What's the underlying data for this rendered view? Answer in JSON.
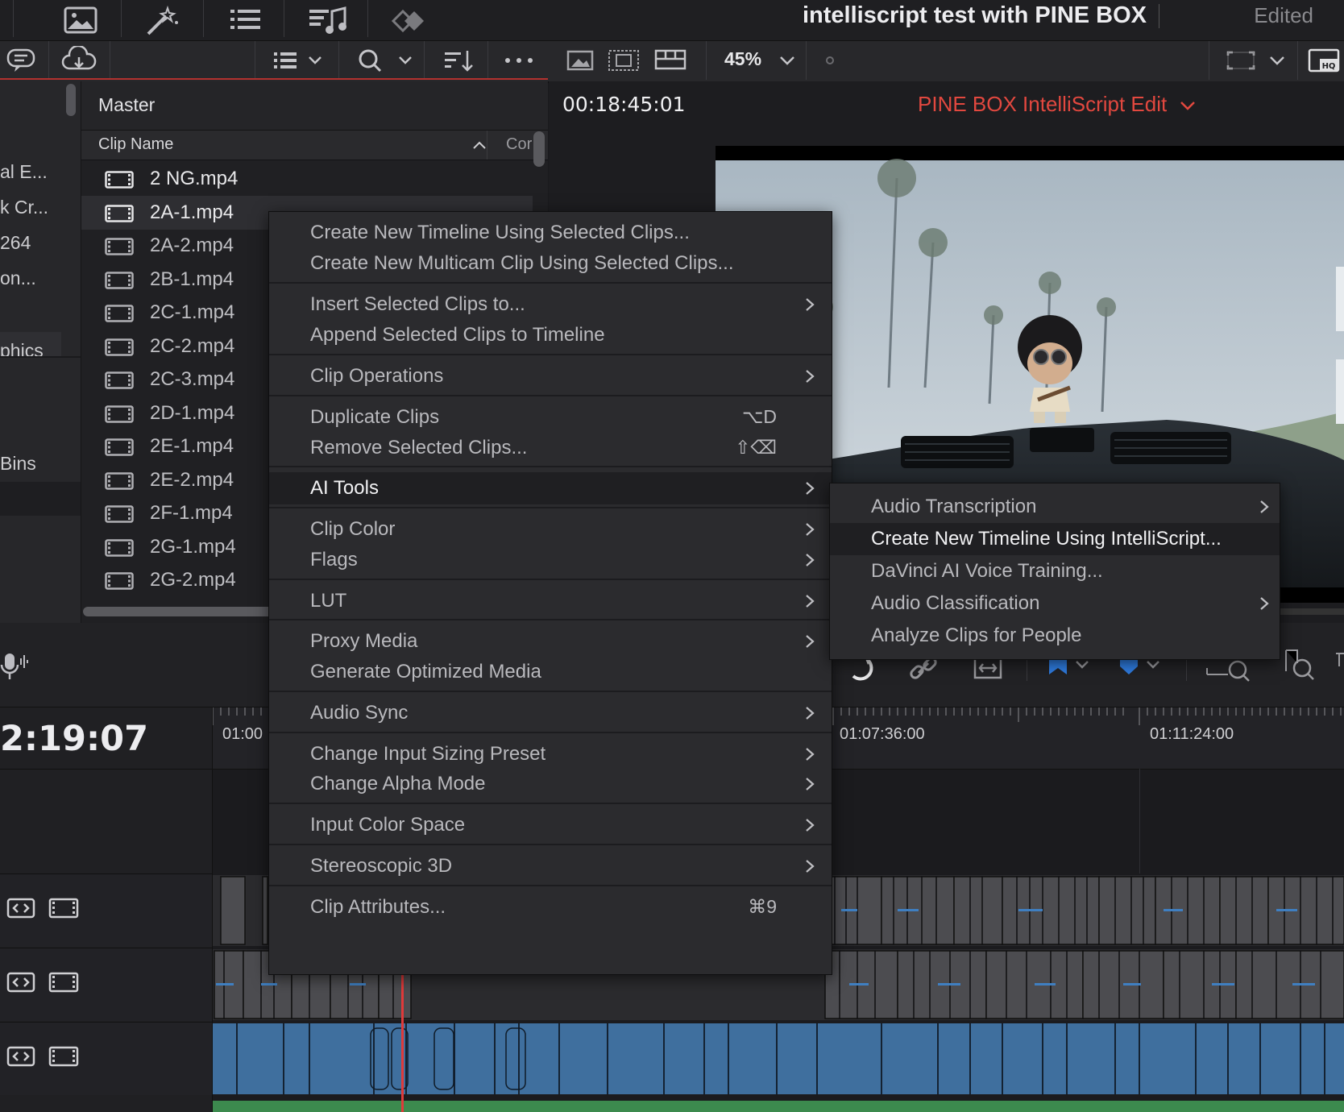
{
  "project": {
    "title": "intelliscript test with PINE BOX",
    "status": "Edited"
  },
  "toolbar": {
    "zoom": "45%"
  },
  "bins": {
    "labels": [
      "al E...",
      "k Cr...",
      "264",
      "on...",
      "phics",
      "Bins"
    ]
  },
  "media_pool": {
    "bin_name": "Master",
    "column_clip_name": "Clip Name",
    "column_cor": "Cor",
    "clips": [
      "2 NG.mp4",
      "2A-1.mp4",
      "2A-2.mp4",
      "2B-1.mp4",
      "2C-1.mp4",
      "2C-2.mp4",
      "2C-3.mp4",
      "2D-1.mp4",
      "2E-1.mp4",
      "2E-2.mp4",
      "2F-1.mp4",
      "2G-1.mp4",
      "2G-2.mp4"
    ]
  },
  "viewer": {
    "timecode": "00:18:45:01",
    "timeline_name": "PINE BOX IntelliScript Edit"
  },
  "timeline": {
    "timecode": "2:19:07",
    "ruler": [
      "01:00",
      "01:07:36:00",
      "01:11:24:00"
    ]
  },
  "context_menu": {
    "items": [
      {
        "label": "Create New Timeline Using Selected Clips..."
      },
      {
        "label": "Create New Multicam Clip Using Selected Clips..."
      },
      {
        "label": "Insert Selected Clips to..."
      },
      {
        "label": "Append Selected Clips to Timeline"
      },
      {
        "label": "Clip Operations"
      },
      {
        "label": "Duplicate Clips",
        "shortcut": "⌥D"
      },
      {
        "label": "Remove Selected Clips...",
        "shortcut": "⇧⌫"
      },
      {
        "label": "AI Tools"
      },
      {
        "label": "Clip Color"
      },
      {
        "label": "Flags"
      },
      {
        "label": "LUT"
      },
      {
        "label": "Proxy Media"
      },
      {
        "label": "Generate Optimized Media"
      },
      {
        "label": "Audio Sync"
      },
      {
        "label": "Change Input Sizing Preset"
      },
      {
        "label": "Change Alpha Mode"
      },
      {
        "label": "Input Color Space"
      },
      {
        "label": "Stereoscopic 3D"
      },
      {
        "label": "Clip Attributes...",
        "shortcut": "⌘9"
      }
    ]
  },
  "submenu": {
    "items": [
      {
        "label": "Audio Transcription"
      },
      {
        "label": "Create New Timeline Using IntelliScript..."
      },
      {
        "label": "DaVinci AI Voice Training..."
      },
      {
        "label": "Audio Classification"
      },
      {
        "label": "Analyze Clips for People"
      }
    ]
  },
  "colors": {
    "accent_red": "#e2483f",
    "clip_blue": "#3f6f9e",
    "audio_green": "#3c8a4e",
    "playhead": "#e03a3a"
  }
}
